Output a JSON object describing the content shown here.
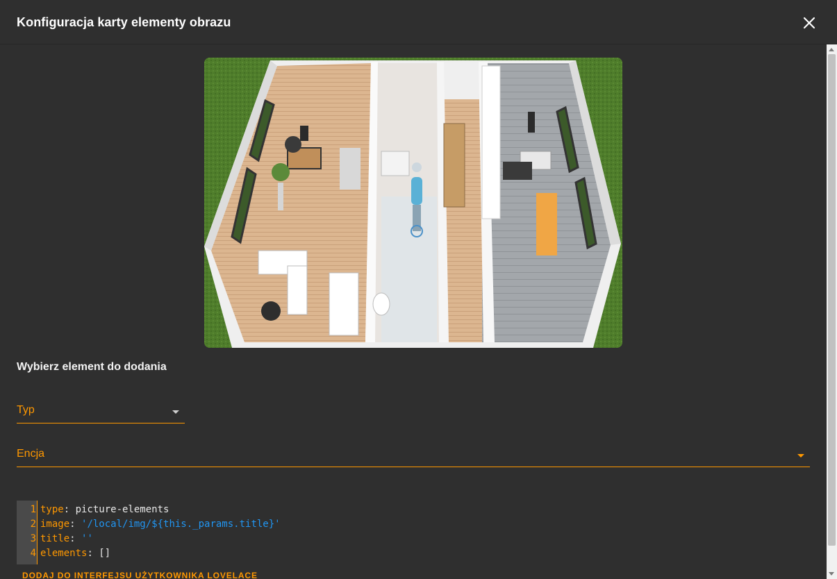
{
  "dialog": {
    "title": "Konfiguracja karty elementy obrazu",
    "close_icon": "close-icon"
  },
  "picture": {
    "description_icon": "floorplan-image",
    "colors": {
      "grass": "#4d7a2a",
      "floor_wood": "#d9b48f",
      "floor_tiles": "#9aa0a6",
      "walls": "#f2f2f2"
    }
  },
  "form": {
    "section_title": "Wybierz element do dodania",
    "type_label": "Typ",
    "entity_label": "Encja"
  },
  "editor": {
    "lines": [
      {
        "num": "1",
        "key": "type",
        "sep": ": ",
        "value": "picture-elements",
        "value_type": "plain"
      },
      {
        "num": "2",
        "key": "image",
        "sep": ": ",
        "value": "'/local/img/${this._params.title}'",
        "value_type": "string"
      },
      {
        "num": "3",
        "key": "title",
        "sep": ": ",
        "value": "''",
        "value_type": "string"
      },
      {
        "num": "4",
        "key": "elements",
        "sep": ": ",
        "value": "[]",
        "value_type": "plain"
      }
    ]
  },
  "actions": {
    "add_label": "DODAJ DO INTERFEJSU UŻYTKOWNIKA LOVELACE"
  },
  "theme": {
    "accent": "#ff9800",
    "background": "#2f2f2f",
    "string_color": "#2196f3"
  }
}
